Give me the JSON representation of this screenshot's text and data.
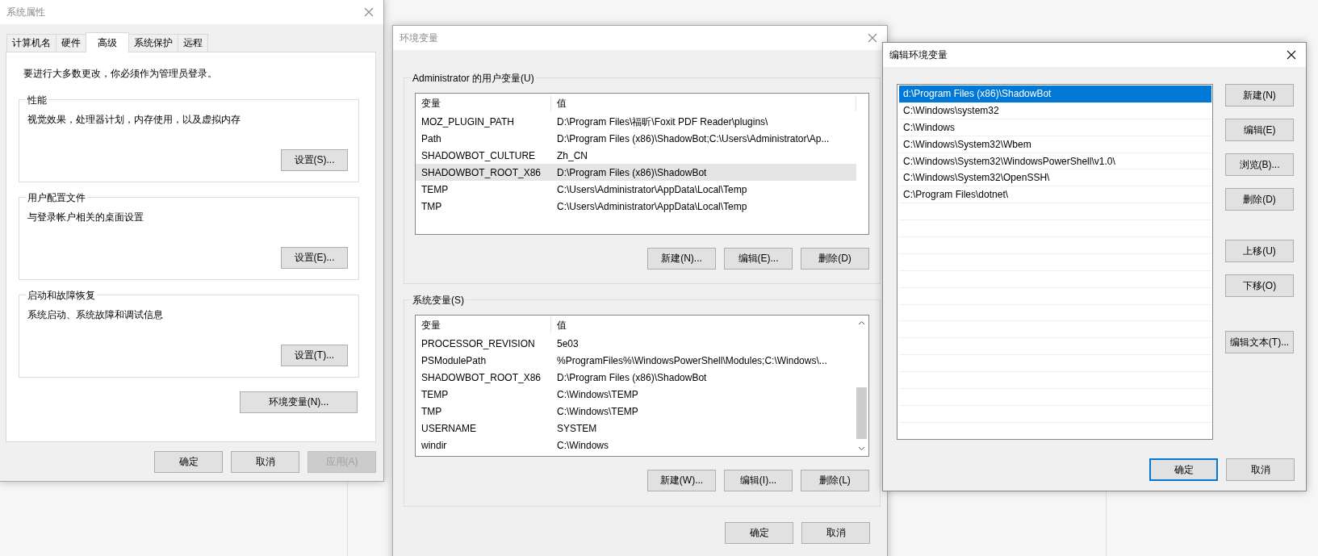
{
  "system_properties": {
    "title": "系统属性",
    "active": false,
    "tabs": [
      {
        "label": "计算机名",
        "selected": false
      },
      {
        "label": "硬件",
        "selected": false
      },
      {
        "label": "高级",
        "selected": true
      },
      {
        "label": "系统保护",
        "selected": false
      },
      {
        "label": "远程",
        "selected": false
      }
    ],
    "notice": "要进行大多数更改，你必须作为管理员登录。",
    "groups": [
      {
        "title": "性能",
        "description": "视觉效果，处理器计划，内存使用，以及虚拟内存",
        "button": "设置(S)..."
      },
      {
        "title": "用户配置文件",
        "description": "与登录帐户相关的桌面设置",
        "button": "设置(E)..."
      },
      {
        "title": "启动和故障恢复",
        "description": "系统启动、系统故障和调试信息",
        "button": "设置(T)..."
      }
    ],
    "env_button": "环境变量(N)...",
    "buttons": [
      {
        "label": "确定",
        "disabled": false
      },
      {
        "label": "取消",
        "disabled": false
      },
      {
        "label": "应用(A)",
        "disabled": true
      }
    ]
  },
  "environment_variables": {
    "title": "环境变量",
    "active": false,
    "user_variables": {
      "title": "Administrator 的用户变量(U)",
      "columns": [
        "变量",
        "值"
      ],
      "rows": [
        {
          "name": "MOZ_PLUGIN_PATH",
          "value": "D:\\Program Files\\福昕\\Foxit PDF Reader\\plugins\\",
          "selected": false
        },
        {
          "name": "Path",
          "value": "D:\\Program Files (x86)\\ShadowBot;C:\\Users\\Administrator\\Ap...",
          "selected": false
        },
        {
          "name": "SHADOWBOT_CULTURE",
          "value": "Zh_CN",
          "selected": false
        },
        {
          "name": "SHADOWBOT_ROOT_X86",
          "value": "D:\\Program Files (x86)\\ShadowBot",
          "selected": true
        },
        {
          "name": "TEMP",
          "value": "C:\\Users\\Administrator\\AppData\\Local\\Temp",
          "selected": false
        },
        {
          "name": "TMP",
          "value": "C:\\Users\\Administrator\\AppData\\Local\\Temp",
          "selected": false
        }
      ],
      "buttons": [
        "新建(N)...",
        "编辑(E)...",
        "删除(D)"
      ]
    },
    "system_variables": {
      "title": "系统变量(S)",
      "columns": [
        "变量",
        "值"
      ],
      "rows": [
        {
          "name": "PROCESSOR_REVISION",
          "value": "5e03",
          "selected": false
        },
        {
          "name": "PSModulePath",
          "value": "%ProgramFiles%\\WindowsPowerShell\\Modules;C:\\Windows\\...",
          "selected": false
        },
        {
          "name": "SHADOWBOT_ROOT_X86",
          "value": "D:\\Program Files (x86)\\ShadowBot",
          "selected": false
        },
        {
          "name": "TEMP",
          "value": "C:\\Windows\\TEMP",
          "selected": false
        },
        {
          "name": "TMP",
          "value": "C:\\Windows\\TEMP",
          "selected": false
        },
        {
          "name": "USERNAME",
          "value": "SYSTEM",
          "selected": false
        },
        {
          "name": "windir",
          "value": "C:\\Windows",
          "selected": false
        }
      ],
      "buttons": [
        "新建(W)...",
        "编辑(I)...",
        "删除(L)"
      ]
    },
    "buttons": [
      "确定",
      "取消"
    ]
  },
  "edit_variable": {
    "title": "编辑环境变量",
    "active": true,
    "entries": [
      {
        "text": "d:\\Program Files (x86)\\ShadowBot",
        "selected": true
      },
      {
        "text": "C:\\Windows\\system32",
        "selected": false
      },
      {
        "text": "C:\\Windows",
        "selected": false
      },
      {
        "text": "C:\\Windows\\System32\\Wbem",
        "selected": false
      },
      {
        "text": "C:\\Windows\\System32\\WindowsPowerShell\\v1.0\\",
        "selected": false
      },
      {
        "text": "C:\\Windows\\System32\\OpenSSH\\",
        "selected": false
      },
      {
        "text": "C:\\Program Files\\dotnet\\",
        "selected": false
      }
    ],
    "buttons": [
      {
        "label": "新建(N)",
        "kind": "action"
      },
      {
        "label": "编辑(E)",
        "kind": "action"
      },
      {
        "label": "浏览(B)...",
        "kind": "action"
      },
      {
        "label": "删除(D)",
        "kind": "action"
      },
      {
        "label": "上移(U)",
        "kind": "move"
      },
      {
        "label": "下移(O)",
        "kind": "move"
      },
      {
        "label": "编辑文本(T)...",
        "kind": "text"
      }
    ],
    "footer_buttons": [
      {
        "label": "确定",
        "default": true
      },
      {
        "label": "取消",
        "default": false
      }
    ]
  }
}
